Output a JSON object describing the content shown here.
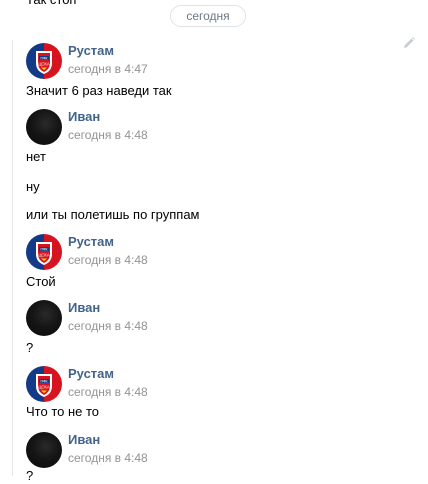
{
  "top_line": "Так стоп",
  "date_separator": "сегодня",
  "groups": [
    {
      "author": "Рустам",
      "avatar": "cska-logo-avatar",
      "time": "сегодня в 4:47",
      "messages": [
        "Значит 6 раз наведи так"
      ]
    },
    {
      "author": "Иван",
      "avatar": "dark-avatar",
      "time": "сегодня в 4:48",
      "messages": [
        "нет",
        "ну",
        "или ты полетишь по группам"
      ]
    },
    {
      "author": "Рустам",
      "avatar": "cska-logo-avatar",
      "time": "сегодня в 4:48",
      "messages": [
        "Стой"
      ]
    },
    {
      "author": "Иван",
      "avatar": "dark-avatar",
      "time": "сегодня в 4:48",
      "messages": [
        "?"
      ]
    },
    {
      "author": "Рустам",
      "avatar": "cska-logo-avatar",
      "time": "сегодня в 4:48",
      "messages": [
        "Что то не то"
      ]
    },
    {
      "author": "Иван",
      "avatar": "dark-avatar",
      "time": "сегодня в 4:48",
      "messages": [
        "?"
      ]
    }
  ],
  "colors": {
    "author": "#42648b",
    "time": "#939393",
    "text": "#000000",
    "pill_border": "#dfe3e8",
    "pill_text": "#6b7886"
  }
}
